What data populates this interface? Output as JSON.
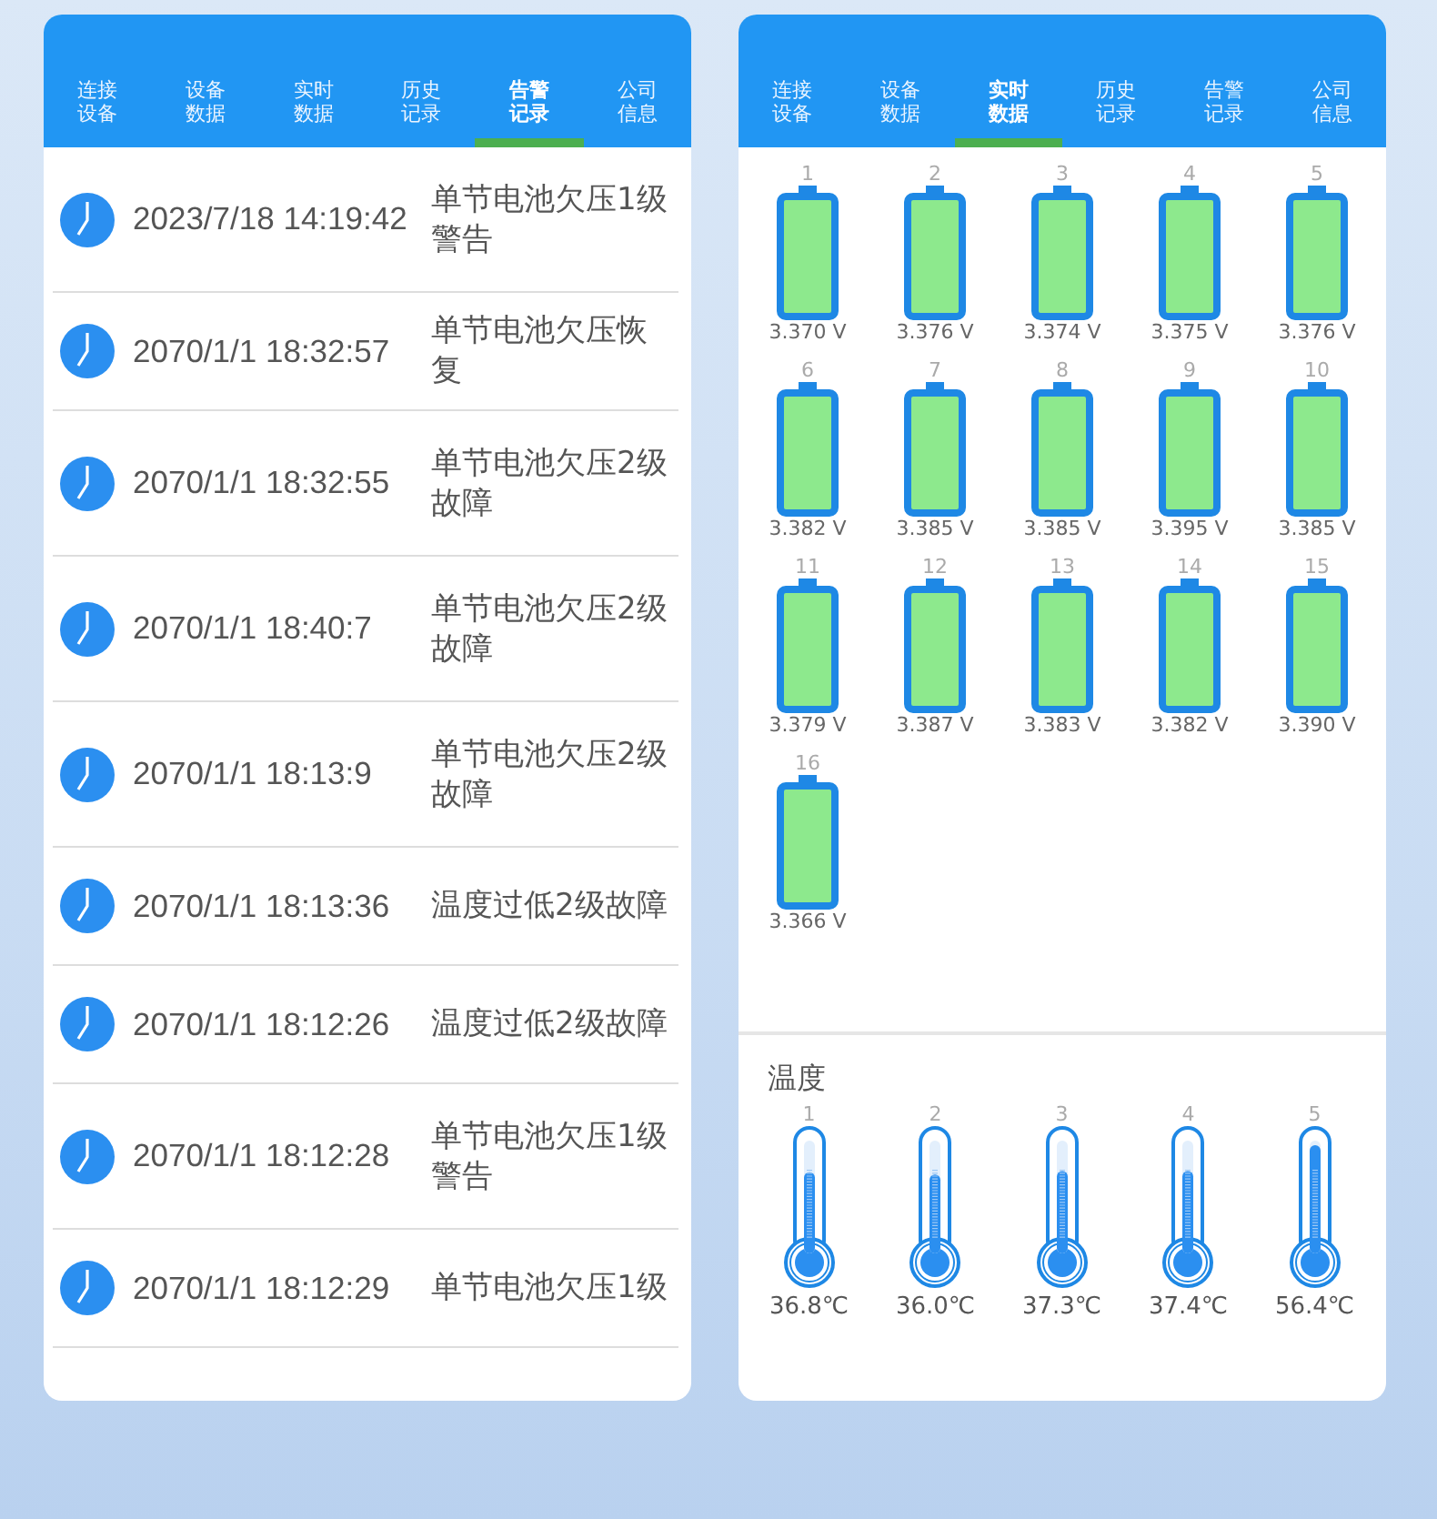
{
  "panels": [
    {
      "tabs": [
        {
          "label": "连接设备",
          "selected": false
        },
        {
          "label": "设备数据",
          "selected": false
        },
        {
          "label": "实时数据",
          "selected": false
        },
        {
          "label": "历史记录",
          "selected": false
        },
        {
          "label": "告警记录",
          "selected": true
        },
        {
          "label": "公司信息",
          "selected": false
        }
      ],
      "alarms": [
        {
          "time": "2023/7/18 14:19:42",
          "message": "单节电池欠压1级警告"
        },
        {
          "time": "2070/1/1 18:32:57",
          "message": "单节电池欠压恢复"
        },
        {
          "time": "2070/1/1 18:32:55",
          "message": "单节电池欠压2级故障"
        },
        {
          "time": "2070/1/1 18:40:7",
          "message": "单节电池欠压2级故障"
        },
        {
          "time": "2070/1/1 18:13:9",
          "message": "单节电池欠压2级故障"
        },
        {
          "time": "2070/1/1 18:13:36",
          "message": "温度过低2级故障"
        },
        {
          "time": "2070/1/1 18:12:26",
          "message": "温度过低2级故障"
        },
        {
          "time": "2070/1/1 18:12:28",
          "message": "单节电池欠压1级警告"
        },
        {
          "time": "2070/1/1 18:12:29",
          "message": "单节电池欠压1级"
        }
      ]
    },
    {
      "tabs": [
        {
          "label": "连接设备",
          "selected": false
        },
        {
          "label": "设备数据",
          "selected": false
        },
        {
          "label": "实时数据",
          "selected": true
        },
        {
          "label": "历史记录",
          "selected": false
        },
        {
          "label": "告警记录",
          "selected": false
        },
        {
          "label": "公司信息",
          "selected": false
        }
      ],
      "cells": [
        {
          "index": "1",
          "voltage": "3.370 V"
        },
        {
          "index": "2",
          "voltage": "3.376 V"
        },
        {
          "index": "3",
          "voltage": "3.374 V"
        },
        {
          "index": "4",
          "voltage": "3.375 V"
        },
        {
          "index": "5",
          "voltage": "3.376 V"
        },
        {
          "index": "6",
          "voltage": "3.382 V"
        },
        {
          "index": "7",
          "voltage": "3.385 V"
        },
        {
          "index": "8",
          "voltage": "3.385 V"
        },
        {
          "index": "9",
          "voltage": "3.395 V"
        },
        {
          "index": "10",
          "voltage": "3.385 V"
        },
        {
          "index": "11",
          "voltage": "3.379 V"
        },
        {
          "index": "12",
          "voltage": "3.387 V"
        },
        {
          "index": "13",
          "voltage": "3.383 V"
        },
        {
          "index": "14",
          "voltage": "3.382 V"
        },
        {
          "index": "15",
          "voltage": "3.390 V"
        },
        {
          "index": "16",
          "voltage": "3.366 V"
        }
      ],
      "temperature": {
        "title": "温度",
        "sensors": [
          {
            "index": "1",
            "level": 0.72,
            "reading": "36.8℃"
          },
          {
            "index": "2",
            "level": 0.7,
            "reading": "36.0℃"
          },
          {
            "index": "3",
            "level": 0.73,
            "reading": "37.3℃"
          },
          {
            "index": "4",
            "level": 0.73,
            "reading": "37.4℃"
          },
          {
            "index": "5",
            "level": 0.96,
            "reading": "56.4℃"
          }
        ]
      }
    }
  ]
}
